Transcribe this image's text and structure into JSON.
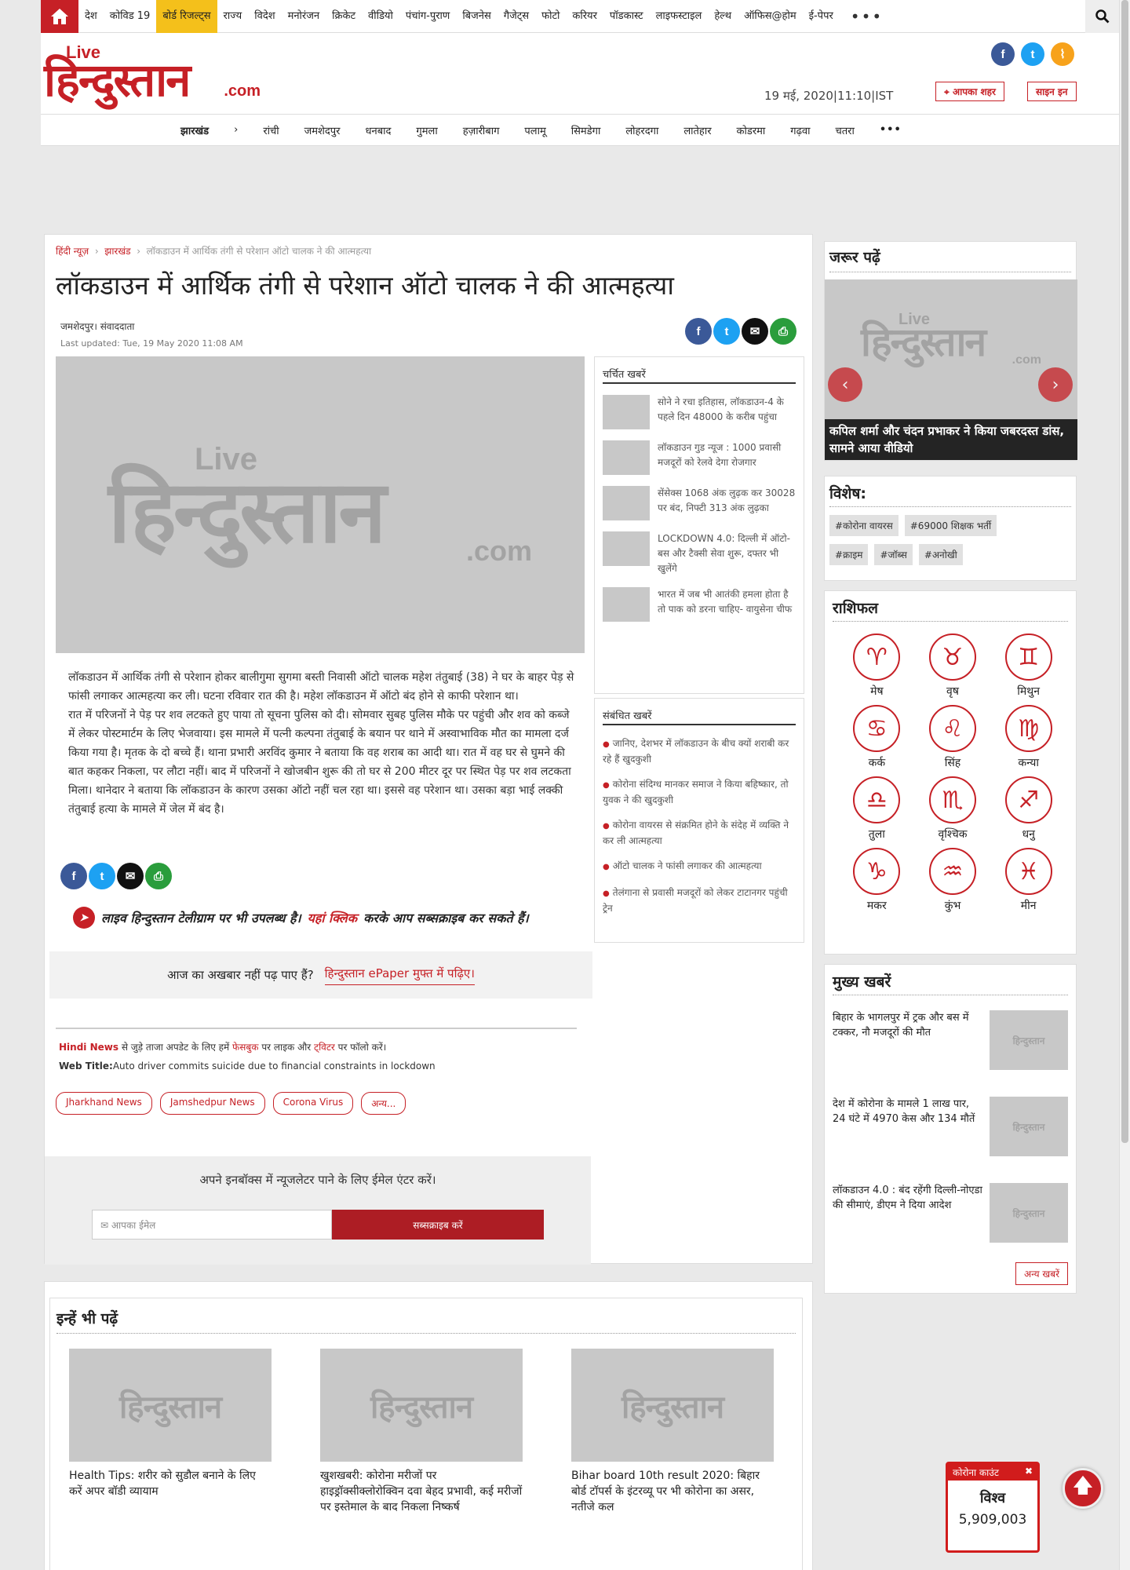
{
  "topnav": {
    "items": [
      "देश",
      "कोविड 19",
      "बोर्ड रिजल्ट्स",
      "राज्य",
      "विदेश",
      "मनोरंजन",
      "क्रिकेट",
      "वीडियो",
      "पंचांग-पुराण",
      "बिजनेस",
      "गैजेट्स",
      "फोटो",
      "करियर",
      "पॉडकास्ट",
      "लाइफस्टाइल",
      "हेल्थ",
      "ऑफिस@होम",
      "ई-पेपर"
    ],
    "more": "•••"
  },
  "header": {
    "logo_live": "Live",
    "logo_main": "हिन्दुस्तान",
    "logo_com": ".com",
    "datetime": "19 मई, 2020|11:10|IST",
    "city_button": "आपका शहर",
    "signin_button": "साइन इन"
  },
  "subnav": {
    "state": "झारखंड",
    "items": [
      "रांची",
      "जमशेदपुर",
      "धनबाद",
      "गुमला",
      "हज़ारीबाग",
      "पलामू",
      "सिमडेगा",
      "लोहरदगा",
      "लातेहार",
      "कोडरमा",
      "गढ़वा",
      "चतरा"
    ]
  },
  "article": {
    "breadcrumb": [
      "हिंदी न्यूज़",
      "झारखंड",
      "लॉकडाउन में आर्थिक तंगी से परेशान ऑटो चालक ने की आत्महत्या"
    ],
    "headline": "लॉकडाउन में आर्थिक तंगी से परेशान ऑटो चालक ने की आत्महत्या",
    "byline": "जमशेदपुर। संवाददाता",
    "updated": "Last updated: Tue, 19 May 2020 11:08 AM",
    "body_p1": "लॉकडाउन में आर्थिक तंगी से परेशान होकर बालीगुमा सुगमा बस्ती निवासी ऑटो चालक महेश तंतुबाई (38) ने घर के बाहर पेड़ से फांसी लगाकर आत्महत्या कर ली। घटना रविवार रात की है। महेश लॉकडाउन में ऑटो बंद होने से काफी परेशान था।",
    "body_p2": "रात में परिजनों ने पेड़ पर शव लटकते हुए पाया तो सूचना पुलिस को दी। सोमवार सुबह पुलिस मौके पर पहुंची और शव को कब्जे में लेकर पोस्टमार्टम के लिए भेजवाया। इस मामले में पत्नी कल्पना तंतुबाई के बयान पर थाने में अस्वाभाविक मौत का मामला दर्ज किया गया है। मृतक के दो बच्चे हैं। थाना प्रभारी अरविंद कुमार ने बताया कि वह शराब का आदी था। रात में वह घर से घुमने की बात कहकर निकला, पर लौटा नहीं। बाद में परिजनों ने खोजबीन शुरू की तो घर से 200 मीटर दूर पर स्थित पेड़ पर शव लटकता मिला। थानेदार ने बताया कि लॉकडाउन के कारण उसका ऑटो नहीं चल रहा था। इससे वह परेशान था। उसका बड़ा भाई लक्की तंतुबाई हत्या के मामले में जेल में बंद है।",
    "telegram_a": "लाइव हिन्दुस्तान टेलीग्राम पर भी उपलब्ध है।",
    "telegram_link": "यहां क्लिक",
    "telegram_b": "करके आप सब्सक्राइब कर सकते हैं।",
    "epaper_text": "आज का अखबार नहीं पढ़ पाए हैं?",
    "epaper_link": "हिन्दुस्तान ePaper मुफ्त में पढ़िए।",
    "hindinews_label": "Hindi News",
    "hindinews_a": "से जुड़े ताजा अपडेट के लिए हमें",
    "hindinews_fb": "फेसबुक",
    "hindinews_b": "पर लाइक और",
    "hindinews_tw": "ट्विटर",
    "hindinews_c": "पर फॉलो करें।",
    "webtitle_label": "Web Title:",
    "webtitle": "Auto driver commits suicide due to financial constraints in lockdown",
    "tags": [
      "Jharkhand News",
      "Jamshedpur News",
      "Corona Virus",
      "अन्य..."
    ]
  },
  "newsletter": {
    "title": "अपने इनबॉक्स में न्यूजलेटर पाने के लिए ईमेल एंटर करें।",
    "placeholder": "आपका ईमेल",
    "button": "सब्सक्राइब करें"
  },
  "charchit": {
    "title": "चर्चित खबरें",
    "items": [
      "सोने ने रचा इतिहास, लॉकडाउन-4 के पहले दिन 48000 के करीब पहुंचा",
      "लॉकडाउन गुड न्यूज : 1000 प्रवासी मजदूरों को रेलवे देगा रोजगार",
      "सेंसेक्स 1068 अंक लुढ़क कर 30028 पर बंद, निफ्टी 313 अंक लुढ़का",
      "LOCKDOWN 4.0: दिल्ली में ऑटो-बस और टैक्सी सेवा शुरू, दफ्तर भी खुलेंगे",
      "भारत में जब भी आतंकी हमला होता है तो पाक को डरना चाहिए- वायुसेना चीफ"
    ]
  },
  "sambandh": {
    "title": "संबंधित खबरें",
    "items": [
      "जानिए, देशभर में लॉकडाउन के बीच क्यों शराबी कर रहे हैं खुदकुशी",
      "कोरोना संदिग्ध मानकर समाज ने किया बहिष्कार, तो युवक ने की खुदकुशी",
      "कोरोना वायरस से संक्रमित होने के संदेह में व्यक्ति ने कर ली आत्महत्या",
      "ऑटो चालक ने फांसी लगाकर की आत्महत्या",
      "तेलंगाना से प्रवासी मजदूरों को लेकर टाटानगर पहुंची ट्रेन"
    ]
  },
  "jarur": {
    "title": "जरूर पढ़ें",
    "caption": "कपिल शर्मा और चंदन प्रभाकर ने किया जबरदस्त डांस, सामने आया वीडियो"
  },
  "vishesh": {
    "title": "विशेष:",
    "tags_row1": [
      "#कोरोना वायरस",
      "#69000 शिक्षक भर्ती"
    ],
    "tags_row2": [
      "#क्राइम",
      "#जॉब्स",
      "#अनोखी"
    ]
  },
  "rashifal": {
    "title": "राशिफल",
    "signs": [
      {
        "name": "मेष",
        "glyph": "♈"
      },
      {
        "name": "वृष",
        "glyph": "♉"
      },
      {
        "name": "मिथुन",
        "glyph": "♊"
      },
      {
        "name": "कर्क",
        "glyph": "♋"
      },
      {
        "name": "सिंह",
        "glyph": "♌"
      },
      {
        "name": "कन्या",
        "glyph": "♍"
      },
      {
        "name": "तुला",
        "glyph": "♎"
      },
      {
        "name": "वृश्चिक",
        "glyph": "♏"
      },
      {
        "name": "धनु",
        "glyph": "♐"
      },
      {
        "name": "मकर",
        "glyph": "♑"
      },
      {
        "name": "कुंभ",
        "glyph": "♒"
      },
      {
        "name": "मीन",
        "glyph": "♓"
      }
    ]
  },
  "mukhya": {
    "title": "मुख्य खबरें",
    "items": [
      "बिहार के भागलपुर में ट्रक और बस में टक्कर, नौ मजदूरों की मौत",
      "देश में कोरोना के मामले 1 लाख पार, 24 घंटे में 4970 केस और 134 मौतें",
      "लॉकडाउन 4.0 : बंद रहेंगी दिल्ली-नोएडा की सीमाएं, डीएम ने दिया आदेश"
    ],
    "more_button": "अन्य खबरें"
  },
  "inhen": {
    "title": "इन्हें भी पढ़ें",
    "items": [
      "Health Tips: शरीर को सुडौल बनाने के लिए करें अपर बॉडी व्यायाम",
      "खुशखबरी: कोरोना मरीजों पर हाइड्रॉक्सीक्लोरोक्विन दवा बेहद प्रभावी, कई मरीजों पर इस्तेमाल के बाद निकला निष्कर्ष",
      "Bihar board 10th result 2020: बिहार बोर्ड टॉपर्स के इंटरव्यू पर भी कोरोना का असर, नतीजे कल"
    ]
  },
  "corona_widget": {
    "title": "कोरोना काउंट",
    "label": "विश्व",
    "count": "5,909,003"
  },
  "colors": {
    "brand_red": "#c62026",
    "highlight_yellow": "#f4c01b",
    "facebook": "#3b5998",
    "twitter": "#1da1f2",
    "rss": "#f7a21b",
    "print": "#2a9d3c"
  }
}
